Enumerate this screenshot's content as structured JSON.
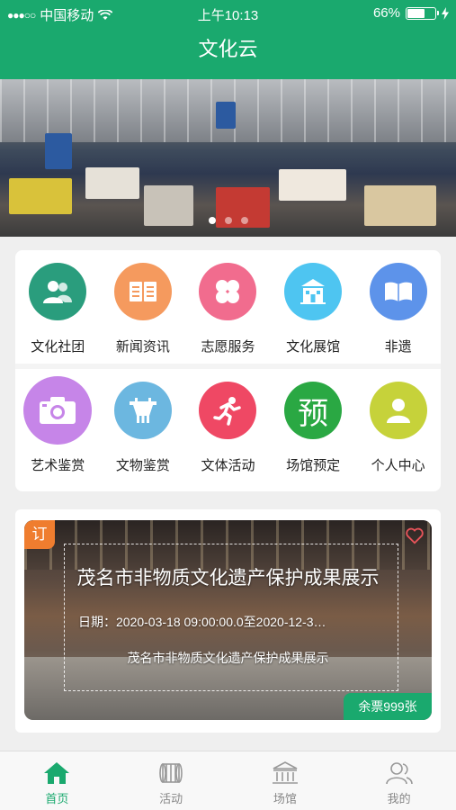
{
  "status_bar": {
    "carrier": "中国移动",
    "time": "上午10:13",
    "battery": "66%",
    "battery_level": 0.66
  },
  "nav": {
    "title": "文化云"
  },
  "banner": {
    "slides": 3,
    "active_index": 0
  },
  "menu": {
    "items": [
      {
        "label": "文化社团",
        "icon": "people-icon",
        "color": "#2a9d7d"
      },
      {
        "label": "新闻资讯",
        "icon": "book-open-icon",
        "color": "#f59a5e"
      },
      {
        "label": "志愿服务",
        "icon": "clover-icon",
        "color": "#f16c8e"
      },
      {
        "label": "文化展馆",
        "icon": "building-icon",
        "color": "#4ec5f1"
      },
      {
        "label": "非遗",
        "icon": "book-icon",
        "color": "#5d93ea"
      },
      {
        "label": "艺术鉴赏",
        "icon": "camera-icon",
        "color": "#c685e8"
      },
      {
        "label": "文物鉴赏",
        "icon": "vessel-icon",
        "color": "#6cb7e0"
      },
      {
        "label": "文体活动",
        "icon": "runner-icon",
        "color": "#ef4864"
      },
      {
        "label": "场馆预定",
        "icon": "reserve-icon",
        "icon_text": "预",
        "color": "#2aa843"
      },
      {
        "label": "个人中心",
        "icon": "user-icon",
        "color": "#c6d23a"
      }
    ]
  },
  "feature": {
    "tag": "订",
    "title": "茂名市非物质文化遗产保护成果展示",
    "date": "日期：2020-03-18 09:00:00.0至2020-12-3…",
    "subtitle": "茂名市非物质文化遗产保护成果展示",
    "tickets": "余票999张",
    "icons": {
      "favorite": "heart-icon"
    }
  },
  "tabbar": {
    "active": 0,
    "items": [
      {
        "label": "首页",
        "icon": "home-icon"
      },
      {
        "label": "活动",
        "icon": "activity-icon"
      },
      {
        "label": "场馆",
        "icon": "venue-icon"
      },
      {
        "label": "我的",
        "icon": "profile-icon"
      }
    ]
  },
  "colors": {
    "brand": "#1aa96e",
    "order_tag": "#ef7d2f"
  }
}
